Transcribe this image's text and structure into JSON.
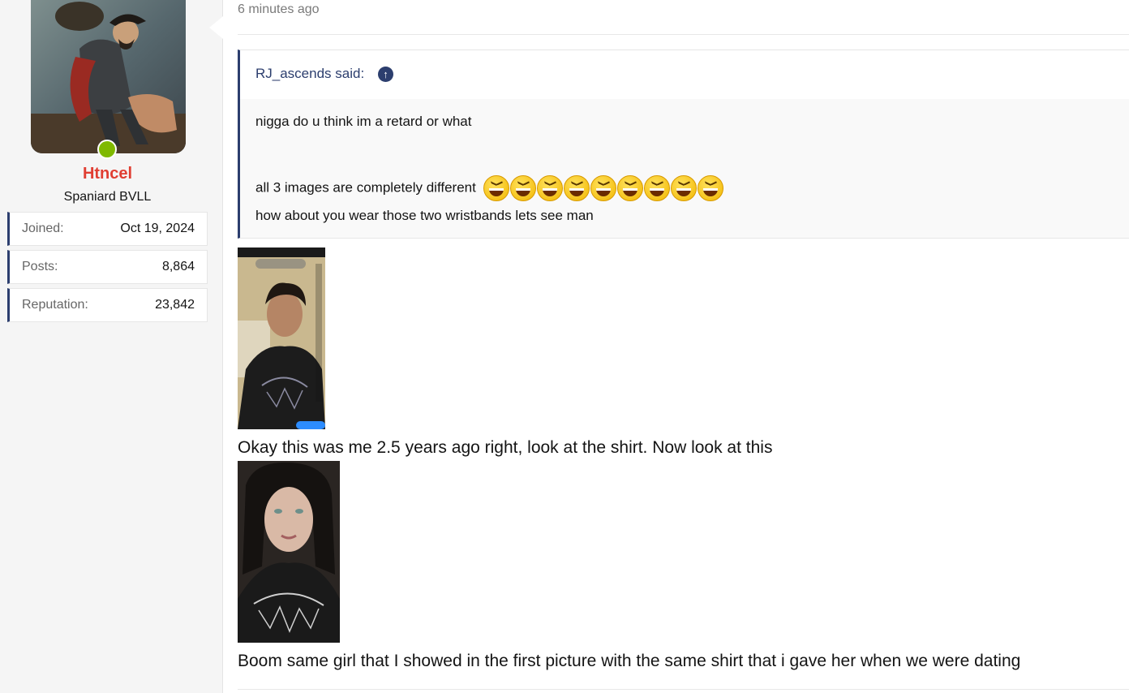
{
  "user": {
    "avatar_name": "avatar",
    "username": "Htncel",
    "title": "Spaniard BVLL",
    "online": true,
    "stats": [
      {
        "label": "Joined:",
        "value": "Oct 19, 2024"
      },
      {
        "label": "Posts:",
        "value": "8,864"
      },
      {
        "label": "Reputation:",
        "value": "23,842"
      }
    ],
    "colors": {
      "username": "#e03e32",
      "accent": "#2c3e6e",
      "online": "#7fb900"
    }
  },
  "post": {
    "time": "6 minutes ago",
    "quote": {
      "author": "RJ_ascends said:",
      "jump_icon": "arrow-up-circle-icon",
      "lines": [
        "nigga do u think im a retard or what",
        "all 3 images are completely different",
        "how about you wear those two wristbands lets see man"
      ],
      "emoji_name": "laughing-face-emoji",
      "emoji_count": 9
    },
    "lines": [
      "Okay this was me 2.5 years ago right, look at the shirt. Now look at this",
      "Boom same girl that I showed in the first picture with the same shirt that i gave her when we were dating"
    ],
    "images": [
      {
        "name": "attached-image-selfie-boy"
      },
      {
        "name": "attached-image-selfie-girl"
      }
    ]
  }
}
